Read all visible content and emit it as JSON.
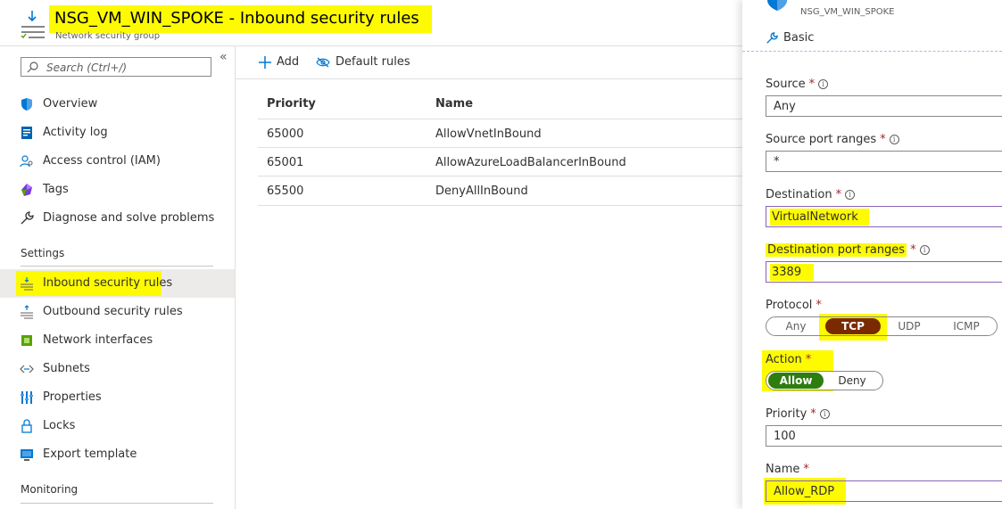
{
  "header": {
    "title": "NSG_VM_WIN_SPOKE - Inbound security rules",
    "subtitle": "Network security group",
    "icon": "inbound-rules-icon"
  },
  "sidebar": {
    "search_placeholder": "Search (Ctrl+/)",
    "items": [
      {
        "label": "Overview",
        "icon": "shield-icon"
      },
      {
        "label": "Activity log",
        "icon": "activity-log-icon"
      },
      {
        "label": "Access control (IAM)",
        "icon": "people-icon"
      },
      {
        "label": "Tags",
        "icon": "tag-icon"
      },
      {
        "label": "Diagnose and solve problems",
        "icon": "wrench-icon"
      }
    ],
    "settings_heading": "Settings",
    "settings_items": [
      {
        "label": "Inbound security rules",
        "icon": "inbound-rules-icon"
      },
      {
        "label": "Outbound security rules",
        "icon": "outbound-rules-icon"
      },
      {
        "label": "Network interfaces",
        "icon": "network-interface-icon"
      },
      {
        "label": "Subnets",
        "icon": "subnet-icon"
      },
      {
        "label": "Properties",
        "icon": "properties-icon"
      },
      {
        "label": "Locks",
        "icon": "lock-icon"
      },
      {
        "label": "Export template",
        "icon": "export-template-icon"
      }
    ],
    "monitoring_heading": "Monitoring"
  },
  "toolbar": {
    "add_label": "Add",
    "default_rules_label": "Default rules"
  },
  "table": {
    "columns": [
      "Priority",
      "Name"
    ],
    "rows": [
      {
        "priority": "65000",
        "name": "AllowVnetInBound"
      },
      {
        "priority": "65001",
        "name": "AllowAzureLoadBalancerInBound"
      },
      {
        "priority": "65500",
        "name": "DenyAllInBound"
      }
    ]
  },
  "panel": {
    "resource_name": "NSG_VM_WIN_SPOKE",
    "tab_label": "Basic",
    "source": {
      "label": "Source",
      "value": "Any"
    },
    "source_ports": {
      "label": "Source port ranges",
      "value": "*"
    },
    "destination": {
      "label": "Destination",
      "value": "VirtualNetwork"
    },
    "dest_ports": {
      "label": "Destination port ranges",
      "value": "3389"
    },
    "protocol": {
      "label": "Protocol",
      "options": [
        "Any",
        "TCP",
        "UDP",
        "ICMP"
      ],
      "selected": "TCP"
    },
    "action": {
      "label": "Action",
      "options": [
        "Allow",
        "Deny"
      ],
      "selected": "Allow"
    },
    "priority": {
      "label": "Priority",
      "value": "100"
    },
    "name": {
      "label": "Name",
      "value": "Allow_RDP"
    },
    "required_mark": "*"
  },
  "colors": {
    "highlight": "#fefb00",
    "tcp_pill": "#7a2a00",
    "allow_pill": "#2e7d0f",
    "azure_blue": "#0078d4"
  }
}
